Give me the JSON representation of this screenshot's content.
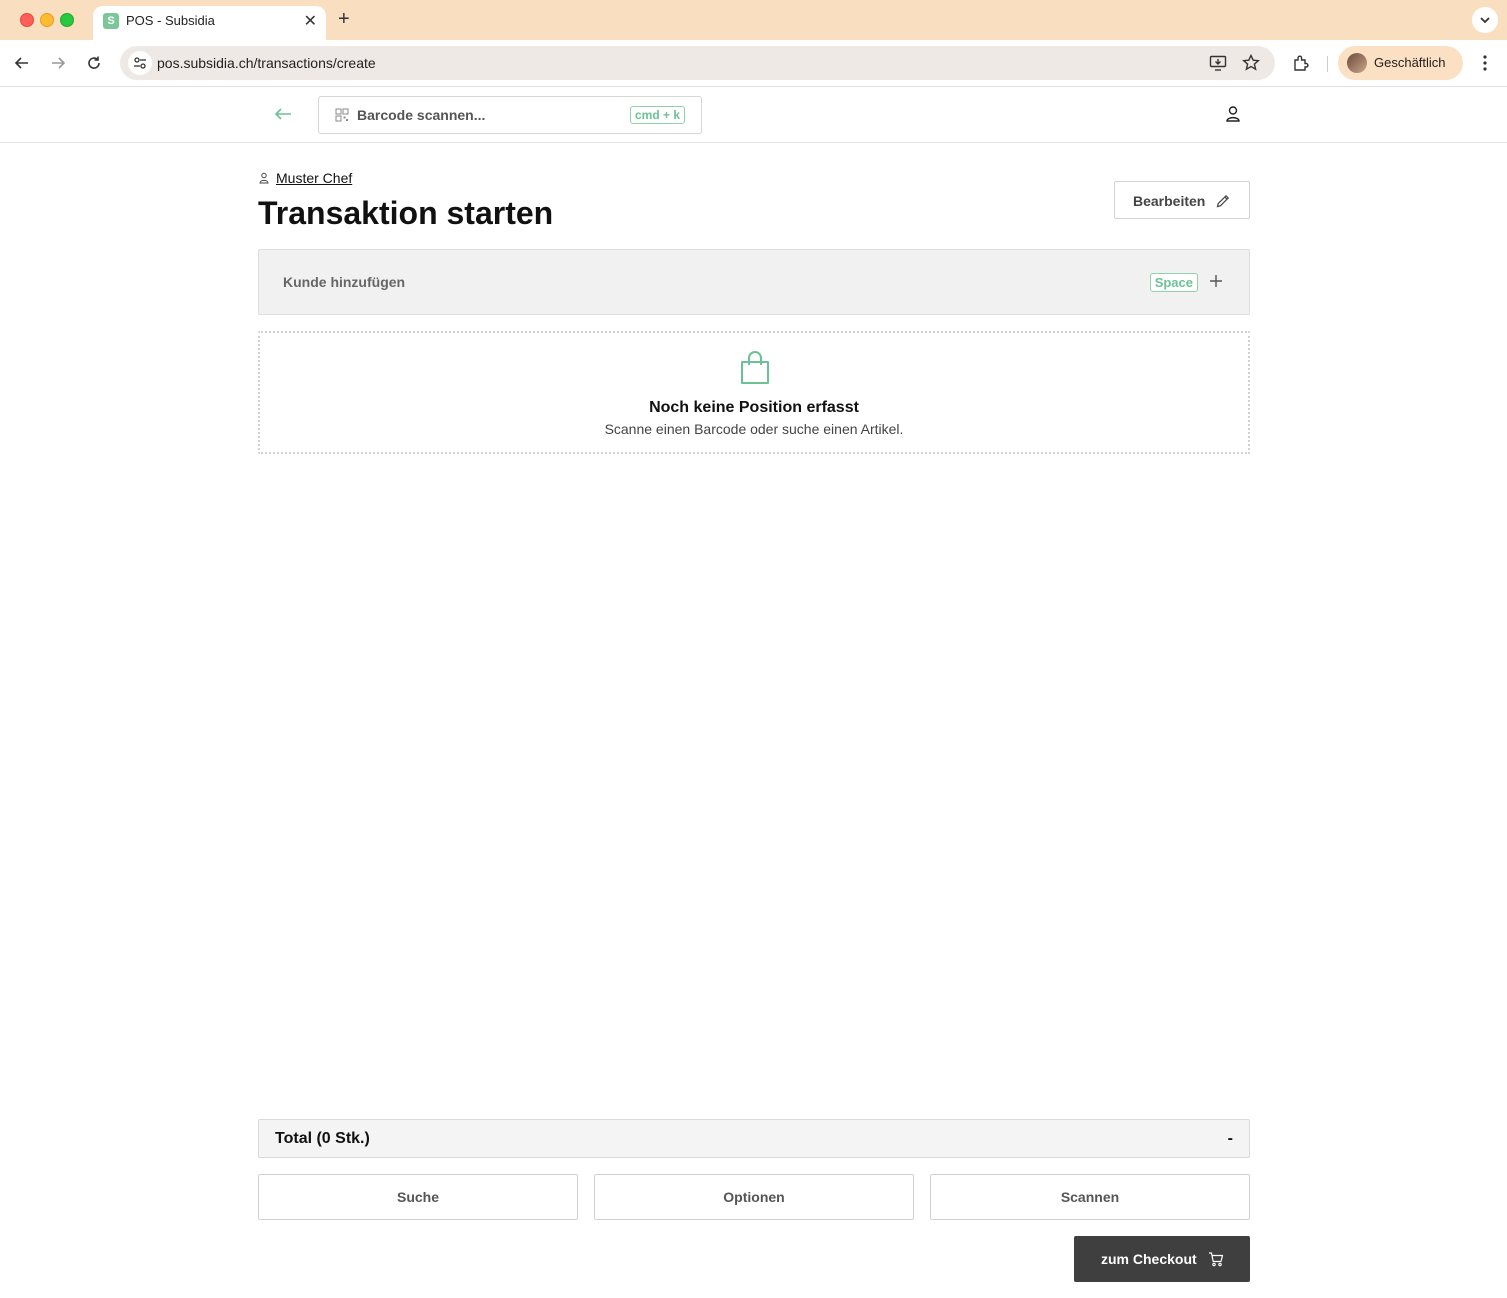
{
  "browser": {
    "tab_title": "POS - Subsidia",
    "favicon_letter": "S",
    "url": "pos.subsidia.ch/transactions/create",
    "profile_label": "Geschäftlich"
  },
  "header": {
    "barcode_placeholder": "Barcode scannen...",
    "barcode_shortcut": "cmd + k"
  },
  "page": {
    "customer_name": "Muster Chef",
    "title_bold": "Transaktion",
    "title_rest": " starten",
    "edit_label": "Bearbeiten"
  },
  "customer_bar": {
    "label": "Kunde hinzufügen",
    "shortcut": "Space"
  },
  "empty_state": {
    "title": "Noch keine Position erfasst",
    "subtitle": "Scanne einen Barcode oder suche einen Artikel."
  },
  "total": {
    "label": "Total (0 Stk.)",
    "value": "-"
  },
  "actions": {
    "search": "Suche",
    "options": "Optionen",
    "scan": "Scannen",
    "checkout": "zum Checkout"
  },
  "colors": {
    "accent_green": "#6cc196",
    "checkout_bg": "#3f3f3f",
    "tabbar_bg": "#f9dfc0"
  }
}
